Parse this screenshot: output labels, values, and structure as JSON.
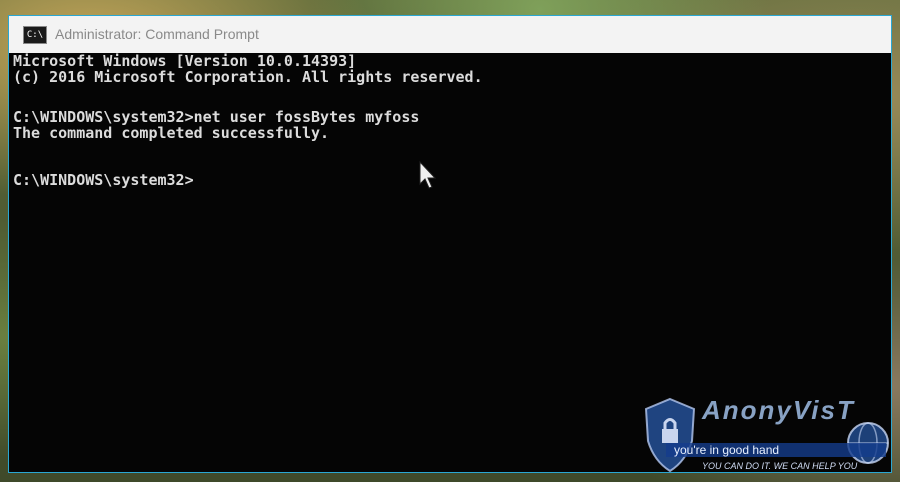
{
  "window": {
    "title": "Administrator: Command Prompt",
    "icon": "cmd-icon",
    "accent_color": "#2aa7d2"
  },
  "console": {
    "lines": [
      "Microsoft Windows [Version 10.0.14393]",
      "(c) 2016 Microsoft Corporation. All rights reserved.",
      "",
      "C:\\WINDOWS\\system32>net user fossBytes myfoss",
      "The command completed successfully.",
      "",
      "",
      "C:\\WINDOWS\\system32>"
    ]
  },
  "watermark": {
    "brand": "AnonyVisT",
    "slogan": "you're in good hand",
    "tagline": "YOU CAN DO IT. WE CAN HELP YOU"
  }
}
